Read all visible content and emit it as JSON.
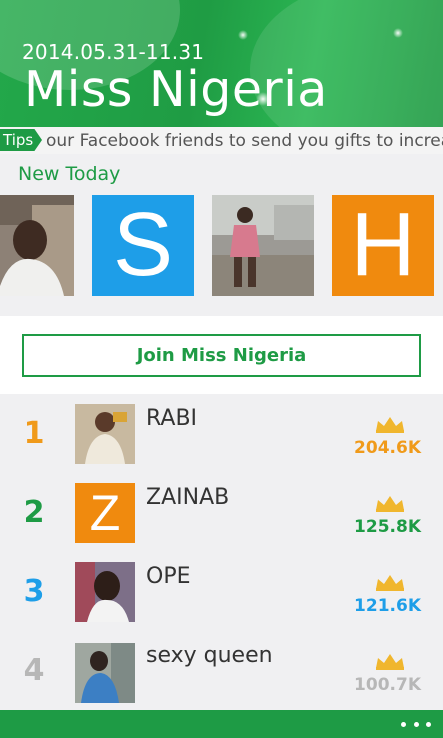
{
  "header": {
    "date_range": "2014.05.31-11.31",
    "title": "Miss Nigeria"
  },
  "tips": {
    "badge": "Tips",
    "text": "our Facebook friends to send you gifts to increase"
  },
  "new_today": {
    "label": "New Today",
    "items": [
      {
        "type": "photo"
      },
      {
        "type": "letter",
        "letter": "S",
        "color": "#1e9ee8"
      },
      {
        "type": "photo"
      },
      {
        "type": "letter",
        "letter": "H",
        "color": "#f08a0e"
      }
    ]
  },
  "join": {
    "label": "Join Miss Nigeria"
  },
  "ranking": [
    {
      "rank": "1",
      "name": "RABI",
      "score": "204.6K",
      "color": "#f09a1a",
      "avatar": "photo"
    },
    {
      "rank": "2",
      "name": "ZAINAB",
      "score": "125.8K",
      "color": "#1e9b45",
      "avatar": "letter",
      "letter": "Z"
    },
    {
      "rank": "3",
      "name": "OPE",
      "score": "121.6K",
      "color": "#1e9ee8",
      "avatar": "photo"
    },
    {
      "rank": "4",
      "name": "sexy queen",
      "score": "100.7K",
      "color": "#b7b7b7",
      "avatar": "photo"
    }
  ],
  "icons": {
    "tips": "tips-badge",
    "crown": "crown-icon",
    "more": "more-icon"
  }
}
